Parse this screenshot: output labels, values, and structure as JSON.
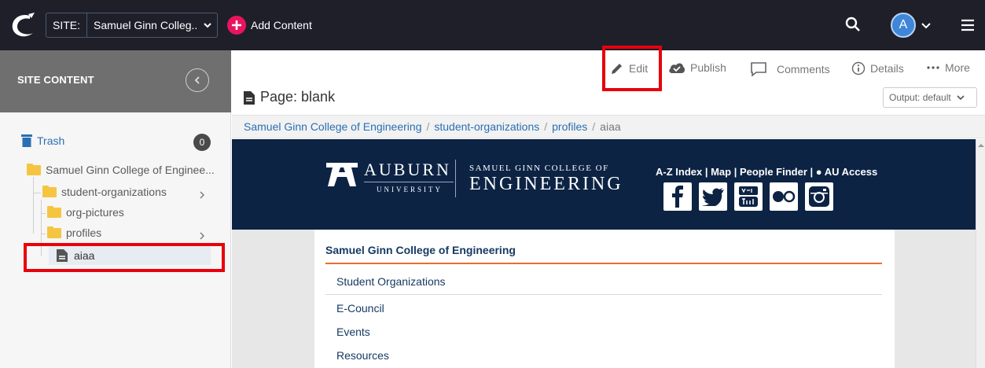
{
  "topbar": {
    "site_label": "SITE:",
    "site_value": "Samuel Ginn Colleg...",
    "add_content_label": "Add Content",
    "avatar_initial": "A"
  },
  "sidebar": {
    "title": "SITE CONTENT",
    "trash_label": "Trash",
    "trash_count": "0",
    "tree": [
      {
        "label": "Samuel Ginn College of Enginee..."
      },
      {
        "label": "student-organizations"
      },
      {
        "label": "org-pictures"
      },
      {
        "label": "profiles"
      },
      {
        "label": "aiaa"
      }
    ]
  },
  "toolbar": {
    "edit": "Edit",
    "publish": "Publish",
    "comments": "Comments",
    "details": "Details",
    "more": "More"
  },
  "page": {
    "title": "Page: blank",
    "output": "Output: default"
  },
  "breadcrumb": [
    "Samuel Ginn College of Engineering",
    "student-organizations",
    "profiles",
    "aiaa"
  ],
  "preview": {
    "auburn": "AUBURN",
    "university": "UNIVERSITY",
    "college_line1": "SAMUEL GINN COLLEGE OF",
    "college_line2": "ENGINEERING",
    "links": "A-Z Index | Map | People Finder | ● AU Access",
    "college_title": "Samuel Ginn College of Engineering",
    "nav": [
      "Student Organizations",
      "E-Council",
      "Events",
      "Resources"
    ]
  },
  "colors": {
    "topbar": "#1f1f2a",
    "accent": "#e8155e",
    "auburn_navy": "#0c2344",
    "auburn_orange": "#e86f2c",
    "highlight_red": "#e8000c"
  }
}
